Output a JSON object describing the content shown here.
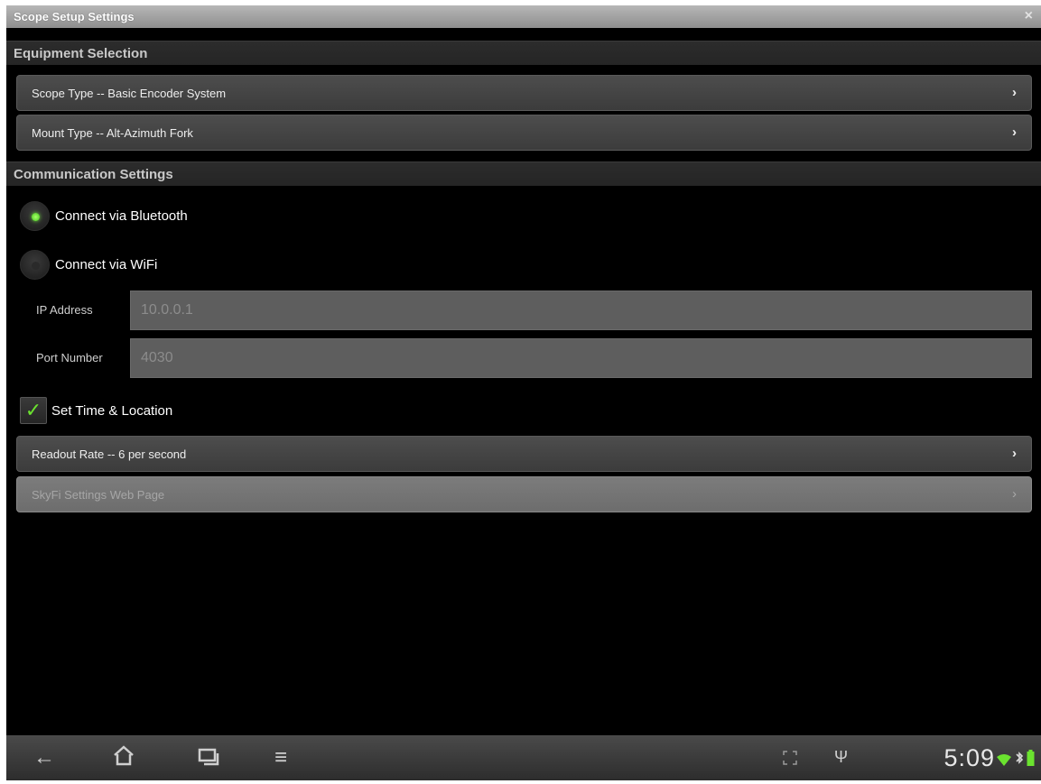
{
  "window": {
    "title": "Scope Setup Settings",
    "close_glyph": "×"
  },
  "sections": {
    "equipment": "Equipment Selection",
    "communication": "Communication Settings"
  },
  "equipment": {
    "scope_type": "Scope Type -- Basic Encoder System",
    "mount_type": "Mount Type -- Alt-Azimuth Fork"
  },
  "communication": {
    "bluetooth_label": "Connect via Bluetooth",
    "bluetooth_selected": true,
    "wifi_label": "Connect via WiFi",
    "wifi_selected": false,
    "ip_label": "IP Address",
    "ip_value": "10.0.0.1",
    "port_label": "Port Number",
    "port_value": "4030",
    "set_time_label": "Set Time & Location",
    "set_time_checked": true,
    "readout_rate": "Readout Rate -- 6 per second",
    "skyfi_web": "SkyFi Settings Web Page"
  },
  "status_bar": {
    "time": "5:09",
    "icons": [
      "back-icon",
      "home-icon",
      "recent-apps-icon",
      "menu-icon",
      "fullscreen-icon",
      "usb-icon",
      "wifi-icon",
      "bluetooth-icon",
      "battery-icon"
    ]
  },
  "colors": {
    "accent_green": "#6be32f",
    "background": "#000000"
  },
  "glyphs": {
    "chevron": "›",
    "check": "✓",
    "back": "←",
    "home": "⌂",
    "menu": "≡",
    "usb": "Ψ",
    "bluetooth": "ʙ"
  }
}
